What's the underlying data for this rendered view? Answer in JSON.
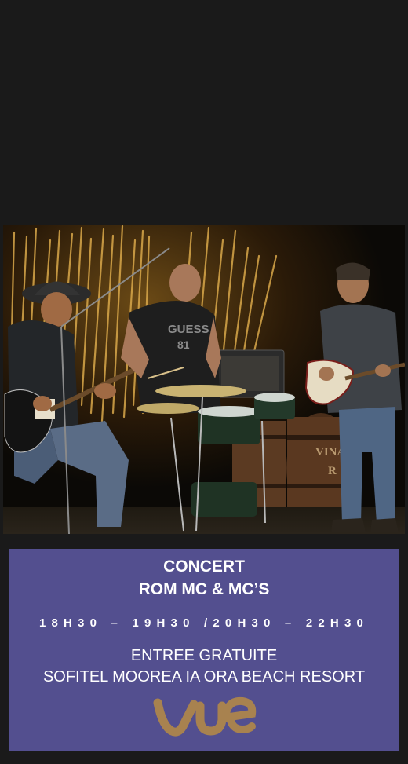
{
  "poster": {
    "title_line1": "CONCERT",
    "title_line2": "ROM MC & MC’S",
    "times": "18H30 – 19H30 /20H30 – 22H30",
    "entry_line1": "ENTREE GRATUITE",
    "entry_line2": "SOFITEL MOOREA IA ORA BEACH RESORT",
    "logo_text": "vue"
  },
  "photo": {
    "barrel_text_1": "VINA",
    "barrel_text_2": "R"
  },
  "colors": {
    "background": "#1a1a1a",
    "panel": "#534f8f",
    "text": "#ffffff",
    "logo": "#a8824f",
    "stage_light": "#c99a3d"
  }
}
